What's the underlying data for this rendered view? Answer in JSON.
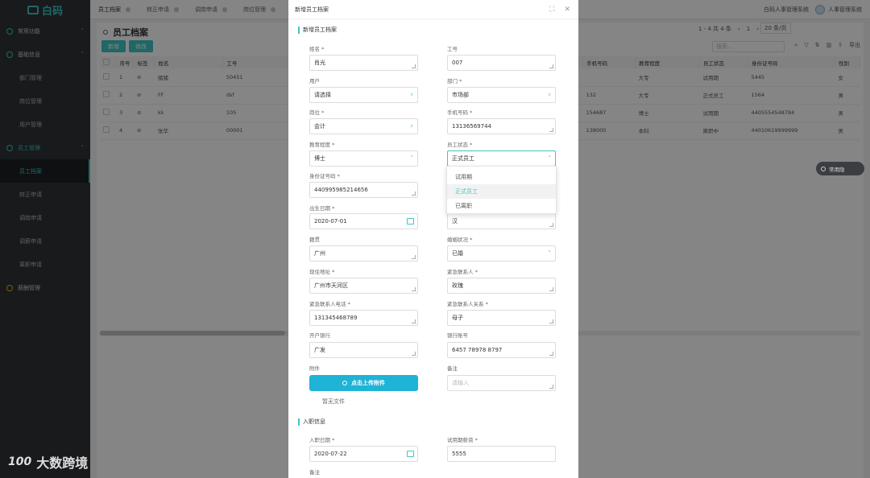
{
  "app": {
    "logo_text": "白码"
  },
  "sidebar": {
    "groups": [
      {
        "label": "常用功能",
        "chevron": "˅"
      },
      {
        "label": "基础信息",
        "chevron": "˄"
      }
    ],
    "basic_items": [
      "部门管理",
      "岗位管理",
      "用户管理"
    ],
    "employee_group": {
      "label": "员工管理",
      "chevron": "˄"
    },
    "employee_items": [
      "员工档案",
      "转正申请",
      "调岗申请",
      "调薪申请",
      "离职申请"
    ],
    "payroll_group": {
      "label": "薪酬管理"
    }
  },
  "topbar": {
    "tabs": [
      "员工档案",
      "转正申请",
      "调岗申请",
      "岗位管理"
    ],
    "system_name": "白码人事管理系统",
    "user_name": "人事管理系统"
  },
  "page": {
    "title": "员工档案",
    "add_button": "新增",
    "edit_button": "修改",
    "pager_text": "1 - 4  共 4 条",
    "page_number": "1",
    "page_size": "20 条/页",
    "search_placeholder": "搜索...",
    "export_label": "导出"
  },
  "table": {
    "left_headers": [
      "序号",
      "标签",
      "姓名",
      "工号"
    ],
    "right_headers": [
      "手机号码",
      "教育程度",
      "员工状态",
      "身份证号码",
      "性别"
    ],
    "rows": [
      {
        "no": "1",
        "name": "猪猪",
        "id": "50451",
        "phone": "",
        "edu": "大专",
        "status": "试用期",
        "idcard": "5445",
        "gender": "女"
      },
      {
        "no": "2",
        "name": "FF",
        "id": "dsf",
        "phone": "132",
        "edu": "大专",
        "status": "正式员工",
        "idcard": "1564",
        "gender": "男"
      },
      {
        "no": "3",
        "name": "kk",
        "id": "105",
        "phone": "154687",
        "edu": "博士",
        "status": "试用期",
        "idcard": "4405554548784",
        "gender": "男"
      },
      {
        "no": "4",
        "name": "张华",
        "id": "00001",
        "phone": "138000",
        "edu": "本科",
        "status": "离职中",
        "idcard": "44010619999999",
        "gender": "男"
      }
    ]
  },
  "float_tag": "常用隐",
  "watermark": {
    "logo": "100",
    "text": "大数跨境"
  },
  "dialog": {
    "title": "新增员工档案",
    "section_basic": "新增员工档案",
    "section_entry": "入职信息",
    "fields": {
      "name": {
        "label": "姓名 *",
        "value": "肖光"
      },
      "emp_no": {
        "label": "工号",
        "value": "007"
      },
      "user": {
        "label": "用户",
        "value": "请选择"
      },
      "dept": {
        "label": "部门 *",
        "value": "市场部"
      },
      "post": {
        "label": "岗位 *",
        "value": "会计"
      },
      "mobile": {
        "label": "手机号码 *",
        "value": "13136569744"
      },
      "edu": {
        "label": "教育程度 *",
        "value": "博士"
      },
      "status": {
        "label": "员工状态 *",
        "value": "正式员工"
      },
      "idcard": {
        "label": "身份证号码 *",
        "value": "440995985214656"
      },
      "birth": {
        "label": "出生日期 *",
        "value": "2020-07-01"
      },
      "nation": {
        "value": "汉"
      },
      "native": {
        "label": "籍贯",
        "value": "广州"
      },
      "marital": {
        "label": "婚姻状况 *",
        "value": "已婚"
      },
      "address": {
        "label": "现住地址 *",
        "value": "广州市天河区"
      },
      "emergency": {
        "label": "紧急联系人 *",
        "value": "玫瑰"
      },
      "emergency_phone": {
        "label": "紧急联系人电话 *",
        "value": "131345468789"
      },
      "emergency_rel": {
        "label": "紧急联系人关系 *",
        "value": "母子"
      },
      "bank": {
        "label": "开户银行",
        "value": "广发"
      },
      "bank_no": {
        "label": "银行账号",
        "value": "6457 78978 8797"
      },
      "attachment": {
        "label": "附件"
      },
      "remark": {
        "label": "备注",
        "placeholder": "请输入"
      },
      "entry_date": {
        "label": "入职日期 *",
        "value": "2020-07-22"
      },
      "trial_salary": {
        "label": "试用期薪资 *",
        "value": "5555"
      },
      "remark2": {
        "label": "备注"
      }
    },
    "upload_label": "点击上传附件",
    "no_file": "暂无文件",
    "status_options": [
      "试用期",
      "正式员工",
      "已离职"
    ]
  }
}
